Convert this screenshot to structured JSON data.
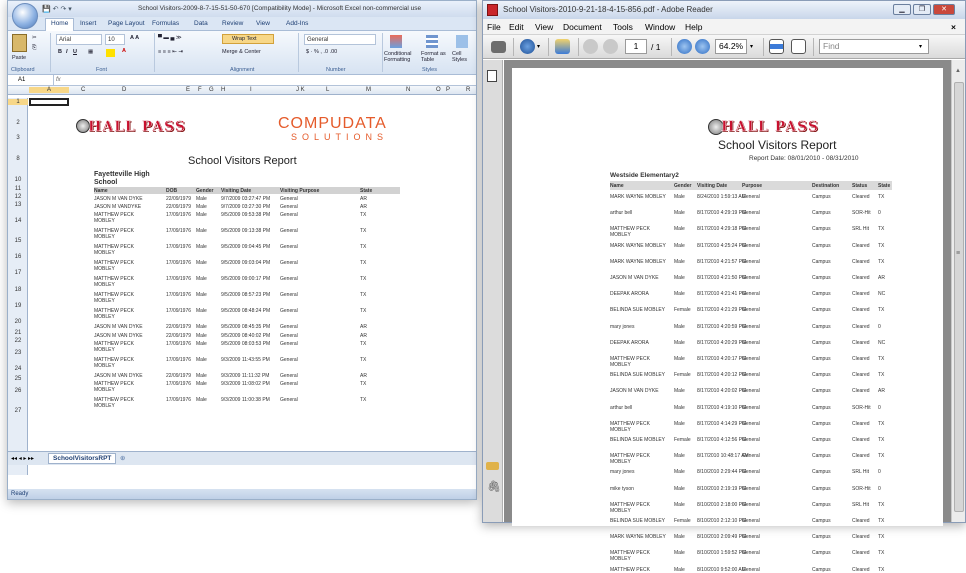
{
  "excel": {
    "title": "School Visitors-2009-8-7-15-51-50-670  [Compatibility Mode] - Microsoft Excel non-commercial use",
    "tabs": [
      "Home",
      "Insert",
      "Page Layout",
      "Formulas",
      "Data",
      "Review",
      "View",
      "Add-Ins"
    ],
    "ribbon": {
      "font_name": "Arial",
      "font_size": "10",
      "wrap_text": "Wrap Text",
      "merge_center": "Merge & Center",
      "number_format": "General",
      "conditional_formatting": "Conditional Formatting",
      "format_as_table": "Format as Table",
      "cell_styles": "Cell Styles",
      "paste": "Paste",
      "groups": [
        "Clipboard",
        "Font",
        "Alignment",
        "Number",
        "Styles"
      ]
    },
    "name_box": "A1",
    "fx": "fx",
    "columns": [
      "A",
      "C",
      "D",
      "E",
      "F",
      "G",
      "H",
      "I",
      "J K",
      "L",
      "M",
      "N",
      "O",
      "P",
      "R"
    ],
    "rows": [
      "1",
      "2",
      "3",
      "8",
      "10",
      "11",
      "12",
      "13",
      "14",
      "15",
      "16",
      "17",
      "18",
      "19",
      "20",
      "21",
      "22",
      "23",
      "24",
      "25",
      "26",
      "27"
    ],
    "logo_hallpass": "HALL PASS",
    "logo_compu": "COMPUDATA",
    "logo_solutions": "SOLUTIONS",
    "report_title": "School Visitors Report",
    "school": "Fayetteville High School",
    "table_headers": [
      "Name",
      "DOB",
      "Gender",
      "Visiting Date",
      "Visiting Purpose",
      "State"
    ],
    "table_rows": [
      [
        "JASON M VAN DYKE",
        "22/09/1979",
        "Male",
        "9/7/2009 03:27:47 PM",
        "General",
        "AR"
      ],
      [
        "JASON M VANDYKE",
        "22/09/1979",
        "Male",
        "9/7/2009 03:27:30 PM",
        "General",
        "AR"
      ],
      [
        "MATTHEW PECK MOBLEY",
        "17/09/1976",
        "Male",
        "9/5/2009 09:53:38 PM",
        "General",
        "TX"
      ],
      [
        "MATTHEW PECK MOBLEY",
        "17/09/1976",
        "Male",
        "9/5/2009 09:13:38 PM",
        "General",
        "TX"
      ],
      [
        "MATTHEW PECK MOBLEY",
        "17/09/1976",
        "Male",
        "9/5/2009 09:04:45 PM",
        "General",
        "TX"
      ],
      [
        "MATTHEW PECK MOBLEY",
        "17/09/1976",
        "Male",
        "9/5/2009 09:03:04 PM",
        "General",
        "TX"
      ],
      [
        "MATTHEW PECK MOBLEY",
        "17/09/1976",
        "Male",
        "9/5/2009 09:00:17 PM",
        "General",
        "TX"
      ],
      [
        "MATTHEW PECK MOBLEY",
        "17/09/1976",
        "Male",
        "9/5/2009 08:57:23 PM",
        "General",
        "TX"
      ],
      [
        "MATTHEW PECK MOBLEY",
        "17/09/1976",
        "Male",
        "9/5/2009 08:48:24 PM",
        "General",
        "TX"
      ],
      [
        "JASON M VAN DYKE",
        "22/09/1979",
        "Male",
        "9/5/2009 08:45:35 PM",
        "General",
        "AR"
      ],
      [
        "JASON M VAN DYKE",
        "22/09/1979",
        "Male",
        "9/5/2009 08:40:02 PM",
        "General",
        "AR"
      ],
      [
        "MATTHEW PECK MOBLEY",
        "17/09/1976",
        "Male",
        "9/5/2009 08:03:53 PM",
        "General",
        "TX"
      ],
      [
        "MATTHEW PECK MOBLEY",
        "17/09/1976",
        "Male",
        "9/3/2009 11:43:55 PM",
        "General",
        "TX"
      ],
      [
        "JASON M VAN DYKE",
        "22/09/1979",
        "Male",
        "9/3/2009 11:11:32 PM",
        "General",
        "AR"
      ],
      [
        "MATTHEW PECK MOBLEY",
        "17/09/1976",
        "Male",
        "9/3/2009 11:08:02 PM",
        "General",
        "TX"
      ],
      [
        "MATTHEW PECK MOBLEY",
        "17/09/1976",
        "Male",
        "9/3/2009 11:00:38 PM",
        "General",
        "TX"
      ]
    ],
    "sheet_tab": "SchoolVisitorsRPT",
    "status": "Ready"
  },
  "reader": {
    "title": "School Visitors-2010-9-21-18-4-15-856.pdf - Adobe Reader",
    "menu": [
      "File",
      "Edit",
      "View",
      "Document",
      "Tools",
      "Window",
      "Help"
    ],
    "page_current": "1",
    "page_total": "/ 1",
    "zoom": "64.2%",
    "find_placeholder": "Find",
    "close_x": "×",
    "logo_hallpass": "HALL PASS",
    "report_title": "School Visitors Report",
    "report_date": "Report Date: 08/01/2010 - 08/31/2010",
    "school": "Westside Elementary2",
    "table_headers": [
      "Name",
      "Gender",
      "Visiting Date",
      "Purpose",
      "Destination",
      "Status",
      "State"
    ],
    "table_rows": [
      [
        "MARK WAYNE MOBLEY",
        "Male",
        "8/24/2010 1:59:13 AM",
        "General",
        "Campus",
        "Cleared",
        "TX"
      ],
      [
        "arthur bell",
        "Male",
        "8/17/2010 4:29:19 PM",
        "General",
        "Campus",
        "SOR-Hit",
        "0"
      ],
      [
        "MATTHEW PECK MOBLEY",
        "Male",
        "8/17/2010 4:29:18 PM",
        "General",
        "Campus",
        "SRL Hit",
        "TX"
      ],
      [
        "MARK WAYNE MOBLEY",
        "Male",
        "8/17/2010 4:25:24 PM",
        "General",
        "Campus",
        "Cleared",
        "TX"
      ],
      [
        "MARK WAYNE MOBLEY",
        "Male",
        "8/17/2010 4:21:57 PM",
        "General",
        "Campus",
        "Cleared",
        "TX"
      ],
      [
        "JASON M VAN DYKE",
        "Male",
        "8/17/2010 4:21:50 PM",
        "General",
        "Campus",
        "Cleared",
        "AR"
      ],
      [
        "DEEPAK ARORA",
        "Male",
        "8/17/2010 4:21:41 PM",
        "General",
        "Campus",
        "Cleared",
        "NC"
      ],
      [
        "BELINDA SUE MOBLEY",
        "Female",
        "8/17/2010 4:21:29 PM",
        "General",
        "Campus",
        "Cleared",
        "TX"
      ],
      [
        "mary jones",
        "Male",
        "8/17/2010 4:20:59 PM",
        "General",
        "Campus",
        "Cleared",
        "0"
      ],
      [
        "DEEPAK ARORA",
        "Male",
        "8/17/2010 4:20:29 PM",
        "General",
        "Campus",
        "Cleared",
        "NC"
      ],
      [
        "MATTHEW PECK MOBLEY",
        "Male",
        "8/17/2010 4:20:17 PM",
        "General",
        "Campus",
        "Cleared",
        "TX"
      ],
      [
        "BELINDA SUE MOBLEY",
        "Female",
        "8/17/2010 4:20:12 PM",
        "General",
        "Campus",
        "Cleared",
        "TX"
      ],
      [
        "JASON M VAN DYKE",
        "Male",
        "8/17/2010 4:20:02 PM",
        "General",
        "Campus",
        "Cleared",
        "AR"
      ],
      [
        "arthur bell",
        "Male",
        "8/17/2010 4:19:10 PM",
        "General",
        "Campus",
        "SOR-Hit",
        "0"
      ],
      [
        "MATTHEW PECK MOBLEY",
        "Male",
        "8/17/2010 4:14:29 PM",
        "General",
        "Campus",
        "Cleared",
        "TX"
      ],
      [
        "BELINDA SUE MOBLEY",
        "Female",
        "8/17/2010 4:12:56 PM",
        "General",
        "Campus",
        "Cleared",
        "TX"
      ],
      [
        "MATTHEW PECK MOBLEY",
        "Male",
        "8/17/2010 10:48:17 AM",
        "General",
        "Campus",
        "Cleared",
        "TX"
      ],
      [
        "mary jones",
        "Male",
        "8/10/2010 2:29:44 PM",
        "General",
        "Campus",
        "SRL Hit",
        "0"
      ],
      [
        "mike tyson",
        "Male",
        "8/10/2010 2:19:19 PM",
        "General",
        "Campus",
        "SOR-Hit",
        "0"
      ],
      [
        "MATTHEW PECK MOBLEY",
        "Male",
        "8/10/2010 2:18:00 PM",
        "General",
        "Campus",
        "SRL Hit",
        "TX"
      ],
      [
        "BELINDA SUE MOBLEY",
        "Female",
        "8/10/2010 2:12:10 PM",
        "General",
        "Campus",
        "Cleared",
        "TX"
      ],
      [
        "MARK WAYNE MOBLEY",
        "Male",
        "8/10/2010 2:09:49 PM",
        "General",
        "Campus",
        "Cleared",
        "TX"
      ],
      [
        "MATTHEW PECK MOBLEY",
        "Male",
        "8/10/2010 1:59:52 PM",
        "General",
        "Campus",
        "Cleared",
        "TX"
      ],
      [
        "MATTHEW PECK",
        "Male",
        "8/10/2010 9:52:00 AM",
        "General",
        "Campus",
        "Cleared",
        "TX"
      ]
    ]
  }
}
